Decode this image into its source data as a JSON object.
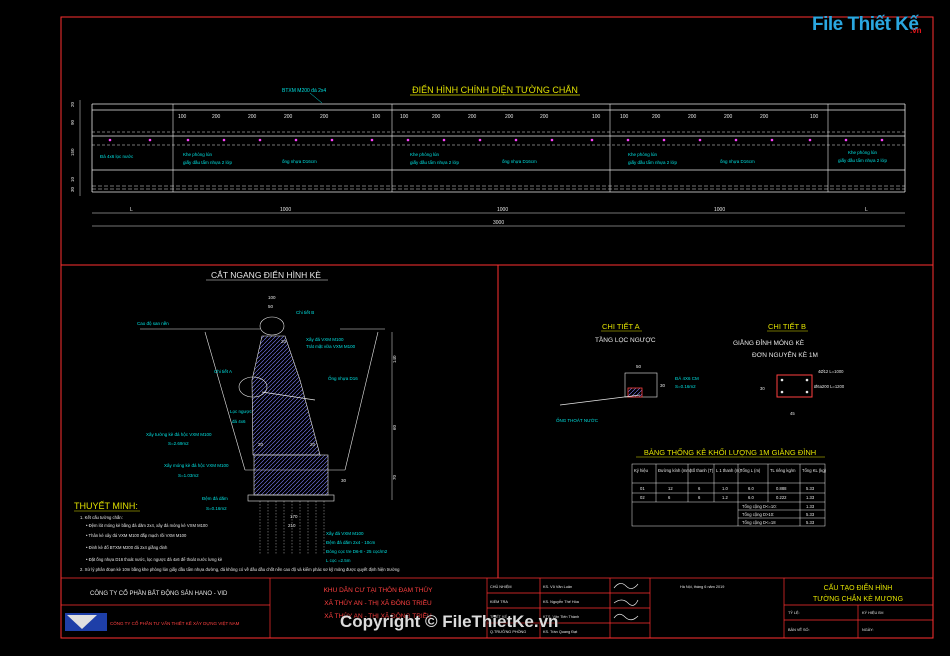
{
  "watermark": {
    "logo_text": "File Thiết Kế",
    "logo_suffix": ".vn",
    "copyright": "Copyright © FileThietKe.vn"
  },
  "elevation": {
    "title": "ĐIỂN HÌNH CHÍNH DIỆN TƯỜNG CHẮN",
    "top_note": "BTXM M200 đá 2x4",
    "left_dims": [
      "20",
      "90",
      "150",
      "10",
      "30"
    ],
    "bay_dims": [
      "100",
      "200",
      "200",
      "200",
      "200",
      "100"
    ],
    "notes": [
      "Đá 4x6 lọc nước",
      "Khe phòng lún",
      "giấy dầu tẩm nhựa 2 lớp",
      "ống nhựa D16cm"
    ],
    "bottom_dims": [
      "L",
      "1000",
      "1000",
      "1000",
      "L"
    ],
    "total_dim": "3000"
  },
  "section": {
    "title": "CẮT NGANG ĐIỂN HÌNH KÈ",
    "labels": [
      "Cao độ san nền",
      "Chi tiết B",
      "Xây đá VXM M100",
      "Trát mặt vữa VXM M100",
      "Chi tiết A",
      "Ống nhựa D16",
      "Lọc ngược",
      "đá 4x6",
      "Xây tường kè đá hộc VXM M100",
      "S=2.69m2",
      "Xây móng kè đá hộc VXM M100",
      "S=1.03m2",
      "Đệm đá dăm",
      "S=0.16m2",
      "Xây đá VXM M100",
      "Đệm đá dăm 2x4 - 10cm",
      "Đóng cọc tre D6-8 - 25 cọc/m2",
      "L cọc =2.5m"
    ],
    "dims": [
      "100",
      "50",
      "20",
      "20",
      "20",
      "170",
      "210",
      "30",
      "140",
      "60",
      "70"
    ]
  },
  "notes_block": {
    "heading": "THUYẾT MINH:",
    "lines": [
      "1. Kết cấu tường chắn:",
      "• Đệm lót móng kè bằng đá dăm 2x4, xây đá móng kè VXM M100",
      "• Thân kè xây đá VXM M100 đắp mạch rồi VXM M100",
      "• Đinh kè đổ BTXM M200 đá 2x4 giằng đinh",
      "• Đặt ống nhựa D16 thoát nước, lọc ngược đá 4x6 để thoát nước lưng kè",
      "2. Xử lý phân đoạn kè 10m bằng khe phòng lún giấy dầu tẩm nhựa đường, đá không có về dầu dầu chốt nền cao độ và kiểm phác sơ kỹ mỏng được quyết định hiện trường"
    ]
  },
  "detail_a": {
    "title": "CHI TIẾT A",
    "subtitle": "TẦNG LỌC NGƯỢC",
    "labels": [
      "50",
      "30",
      "ĐÁ 4X6 CM",
      "S=0.16m2",
      "ỐNG THOÁT NƯỚC"
    ]
  },
  "detail_b": {
    "title": "CHI TIẾT B",
    "subtitle1": "GIẰNG ĐỈNH MÓNG KÈ",
    "subtitle2": "ĐƠN NGUYÊN KÈ 1M",
    "labels": [
      "4Ø12 L=1000",
      "Ø6a200 L=1200",
      "45",
      "30"
    ]
  },
  "table": {
    "title": "BẢNG THỐNG KÊ KHỐI LƯỢNG 1M GIẰNG ĐỈNH",
    "headers": [
      "Ký hiệu",
      "Đường kính (mm)",
      "Số thanh (T)",
      "L 1 thanh (m)",
      "Tổng L (m)",
      "TL riêng kg/m",
      "Tổng KL (kg)"
    ],
    "rows": [
      [
        "01",
        "12",
        "6",
        "1.0",
        "6.0",
        "0.888",
        "5.33"
      ],
      [
        "02",
        "6",
        "6",
        "1.2",
        "6.0",
        "0.222",
        "1.33"
      ]
    ],
    "summary": [
      [
        "Tổng cộng D<=10:",
        "1.33"
      ],
      [
        "Tổng cộng D>10:",
        "5.33"
      ],
      [
        "Tổng cộng D<=18",
        "5.33"
      ]
    ]
  },
  "title_block": {
    "company": "CÔNG TY CỔ PHẦN BẤT ĐỘNG SẢN HANO - VID",
    "consultant": "CÔNG TY CỔ PHẦN TƯ VẤN THIẾT KẾ XÂY DỰNG VIỆT NAM",
    "project_lines": [
      "KHU DÂN CƯ TẠI THÔN ĐẠM THỦY",
      "XÃ THỦY AN - THỊ XÃ ĐÔNG TRIỀU",
      "XÃ THỦY AN - THỊ XÃ ĐÔNG TRIỀU"
    ],
    "roles": [
      "CHỦ NHIỆM",
      "KIỂM TRA",
      "THIẾT KẾ",
      "Q.TRƯỞNG PHÒNG"
    ],
    "names": [
      "KS. Vũ Văn Luân",
      "KS. Nguyễn Thế Hòa",
      "KTS. Văn Tiến Thành",
      "KS. Trần Quang Đạt"
    ],
    "date_line": "Hà Nội, tháng 6 năm 2019",
    "drawing_title_1": "CẤU TẠO ĐIỂN HÌNH",
    "drawing_title_2": "TƯỜNG CHẮN KÈ MƯƠNG",
    "meta": [
      "TỶ LỆ:",
      "BẢN VẼ SỐ:",
      "KÝ HIỆU BV:",
      "NGÀY:"
    ]
  }
}
